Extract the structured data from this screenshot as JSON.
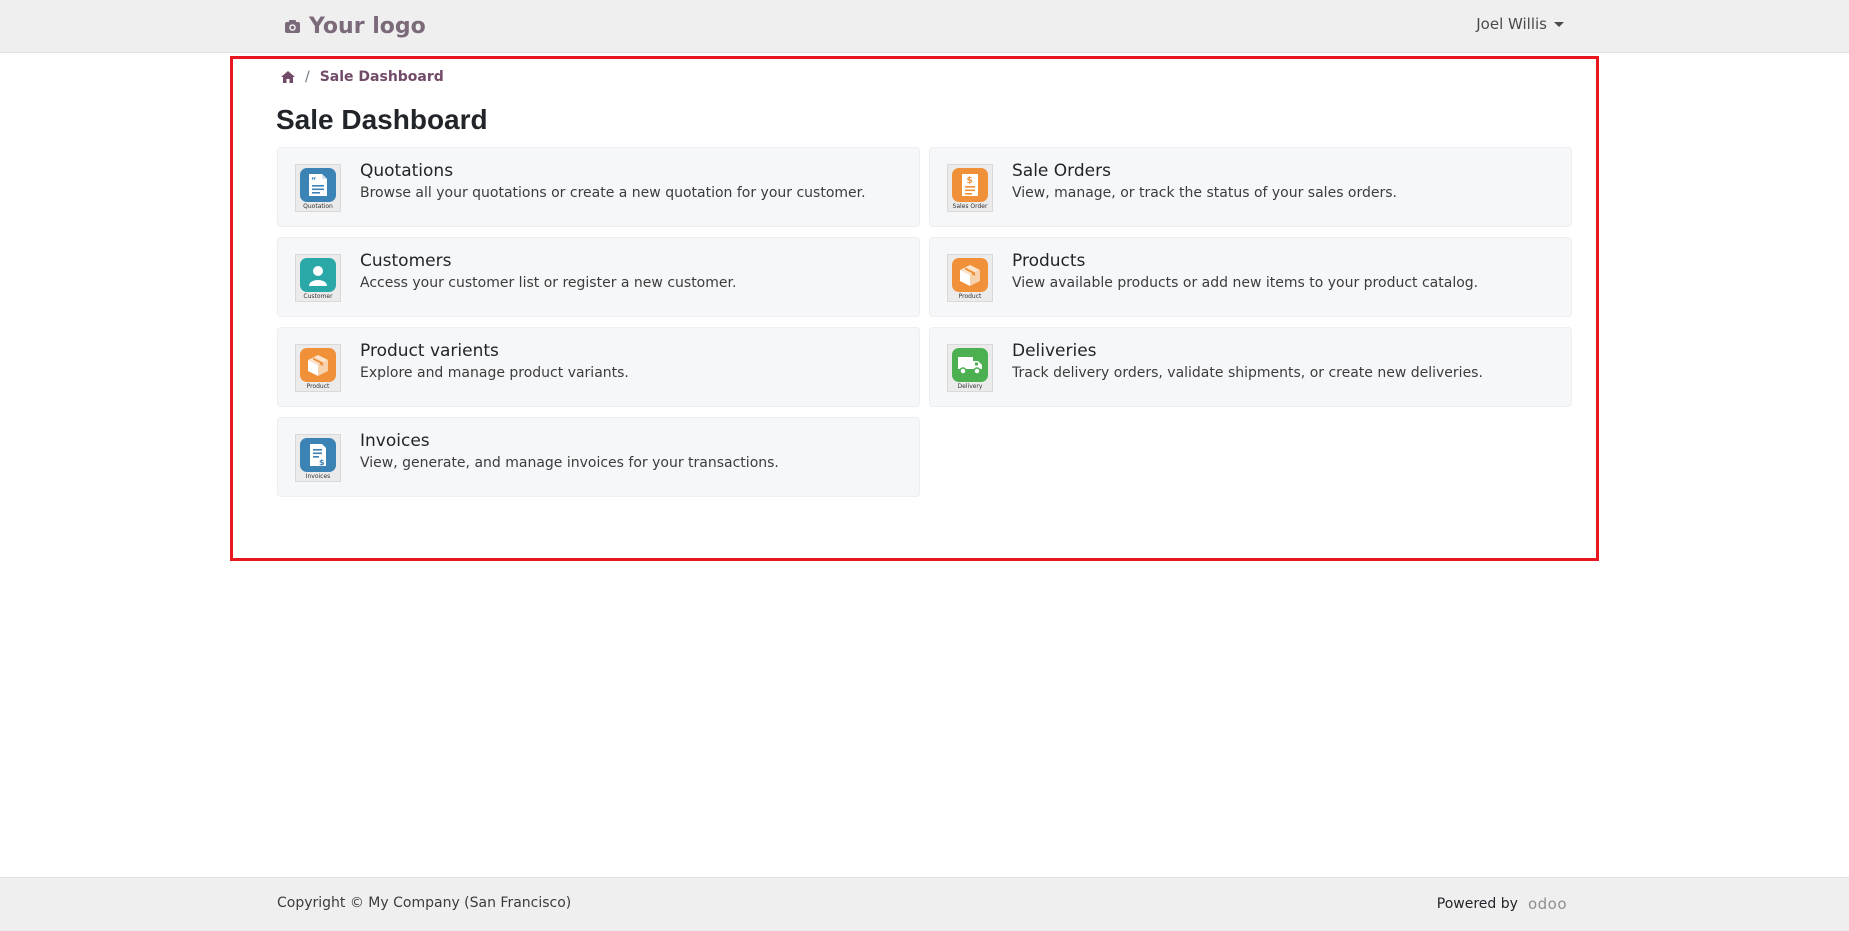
{
  "header": {
    "logo_text": "Your logo",
    "user_name": "Joel Willis"
  },
  "breadcrumb": {
    "separator": "/",
    "current": "Sale Dashboard"
  },
  "page": {
    "title": "Sale Dashboard"
  },
  "cards": [
    {
      "title": "Quotations",
      "description": "Browse all your quotations or create a new quotation for your customer.",
      "icon_caption": "Quotation",
      "icon": "quotation-icon",
      "color": "#3b82b5"
    },
    {
      "title": "Sale Orders",
      "description": "View, manage, or track the status of your sales orders.",
      "icon_caption": "Sales Order",
      "icon": "sale-order-icon",
      "color": "#f0913a"
    },
    {
      "title": "Customers",
      "description": "Access your customer list or register a new customer.",
      "icon_caption": "Customer",
      "icon": "customer-icon",
      "color": "#2aa8a8"
    },
    {
      "title": "Products",
      "description": "View available products or add new items to your product catalog.",
      "icon_caption": "Product",
      "icon": "product-icon",
      "color": "#f0913a"
    },
    {
      "title": "Product varients",
      "description": "Explore and manage product variants.",
      "icon_caption": "Product",
      "icon": "product-icon",
      "color": "#f0913a"
    },
    {
      "title": "Deliveries",
      "description": "Track delivery orders, validate shipments, or create new deliveries.",
      "icon_caption": "Delivery",
      "icon": "delivery-truck-icon",
      "color": "#4caf50"
    },
    {
      "title": "Invoices",
      "description": "View, generate, and manage invoices for your transactions.",
      "icon_caption": "Invoices",
      "icon": "invoice-icon",
      "color": "#3b82b5"
    }
  ],
  "footer": {
    "copyright": "Copyright © My Company (San Francisco)",
    "powered_by": "Powered by",
    "brand": "odoo"
  },
  "colors": {
    "brand": "#714B67",
    "highlight_border": "#e8161e"
  }
}
